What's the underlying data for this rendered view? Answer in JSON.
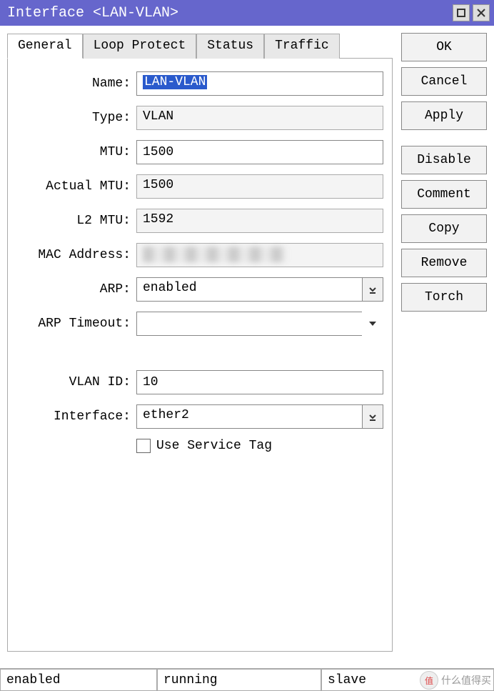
{
  "window": {
    "title": "Interface <LAN-VLAN>"
  },
  "tabs": [
    {
      "label": "General",
      "active": true
    },
    {
      "label": "Loop Protect",
      "active": false
    },
    {
      "label": "Status",
      "active": false
    },
    {
      "label": "Traffic",
      "active": false
    }
  ],
  "fields": {
    "name": {
      "label": "Name:",
      "value": "LAN-VLAN"
    },
    "type": {
      "label": "Type:",
      "value": "VLAN"
    },
    "mtu": {
      "label": "MTU:",
      "value": "1500"
    },
    "actual_mtu": {
      "label": "Actual MTU:",
      "value": "1500"
    },
    "l2_mtu": {
      "label": "L2 MTU:",
      "value": "1592"
    },
    "mac": {
      "label": "MAC Address:",
      "value": ""
    },
    "arp": {
      "label": "ARP:",
      "value": "enabled"
    },
    "arp_timeout": {
      "label": "ARP Timeout:",
      "value": ""
    },
    "vlan_id": {
      "label": "VLAN ID:",
      "value": "10"
    },
    "interface": {
      "label": "Interface:",
      "value": "ether2"
    },
    "use_service_tag": {
      "label": "Use Service Tag",
      "checked": false
    }
  },
  "buttons": {
    "ok": "OK",
    "cancel": "Cancel",
    "apply": "Apply",
    "disable": "Disable",
    "comment": "Comment",
    "copy": "Copy",
    "remove": "Remove",
    "torch": "Torch"
  },
  "status": {
    "s1": "enabled",
    "s2": "running",
    "s3": "slave"
  },
  "watermark": "什么值得买"
}
